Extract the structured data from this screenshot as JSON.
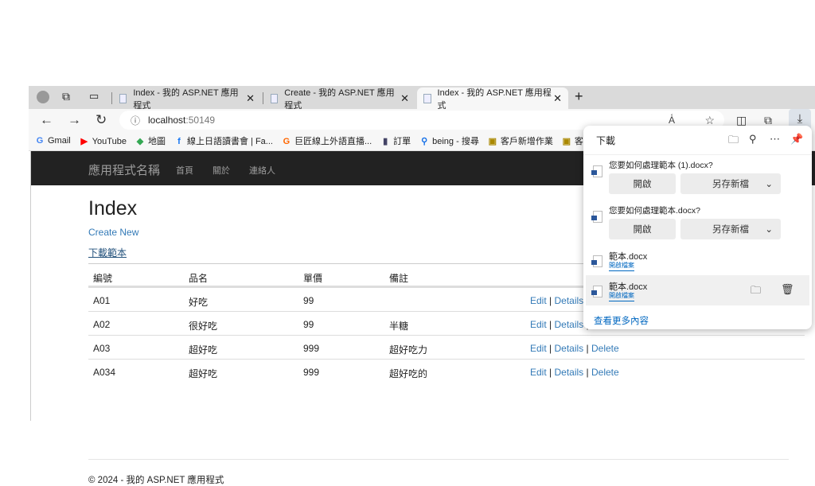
{
  "tabs": [
    {
      "label": "Index - 我的 ASP.NET 應用程式"
    },
    {
      "label": "Create - 我的 ASP.NET 應用程式"
    },
    {
      "label": "Index - 我的 ASP.NET 應用程式"
    }
  ],
  "address": {
    "host": "localhost",
    "port": ":50149"
  },
  "bookmarks": [
    "Gmail",
    "YouTube",
    "地圖",
    "線上日語讀書會 | Fa...",
    "巨匠線上外語直播...",
    "訂單",
    "being - 搜尋",
    "客戶新增作業",
    "客戶進"
  ],
  "nav": {
    "brand": "應用程式名稱",
    "links": [
      "首頁",
      "關於",
      "連絡人"
    ]
  },
  "main": {
    "title": "Index",
    "create": "Create New",
    "download": "下載範本",
    "headers": [
      "編號",
      "品名",
      "單價",
      "備註"
    ],
    "rows": [
      [
        "A01",
        "好吃",
        "99",
        ""
      ],
      [
        "A02",
        "很好吃",
        "99",
        "半糖"
      ],
      [
        "A03",
        "超好吃",
        "999",
        "超好吃力"
      ],
      [
        "A034",
        "超好吃",
        "999",
        "超好吃的"
      ]
    ],
    "actions": {
      "edit": "Edit",
      "details": "Details",
      "delete": "Delete",
      "sep": "|"
    },
    "footer": "© 2024 - 我的 ASP.NET 應用程式"
  },
  "downloads": {
    "title": "下載",
    "items": [
      {
        "question": "您要如何處理範本 (1).docx?",
        "open": "開啟",
        "saveas": "另存新檔"
      },
      {
        "question": "您要如何處理範本.docx?",
        "open": "開啟",
        "saveas": "另存新檔"
      }
    ],
    "files": [
      {
        "name": "範本.docx",
        "link": "開啟檔案"
      },
      {
        "name": "範本.docx",
        "link": "開啟檔案"
      }
    ],
    "more": "查看更多內容"
  }
}
